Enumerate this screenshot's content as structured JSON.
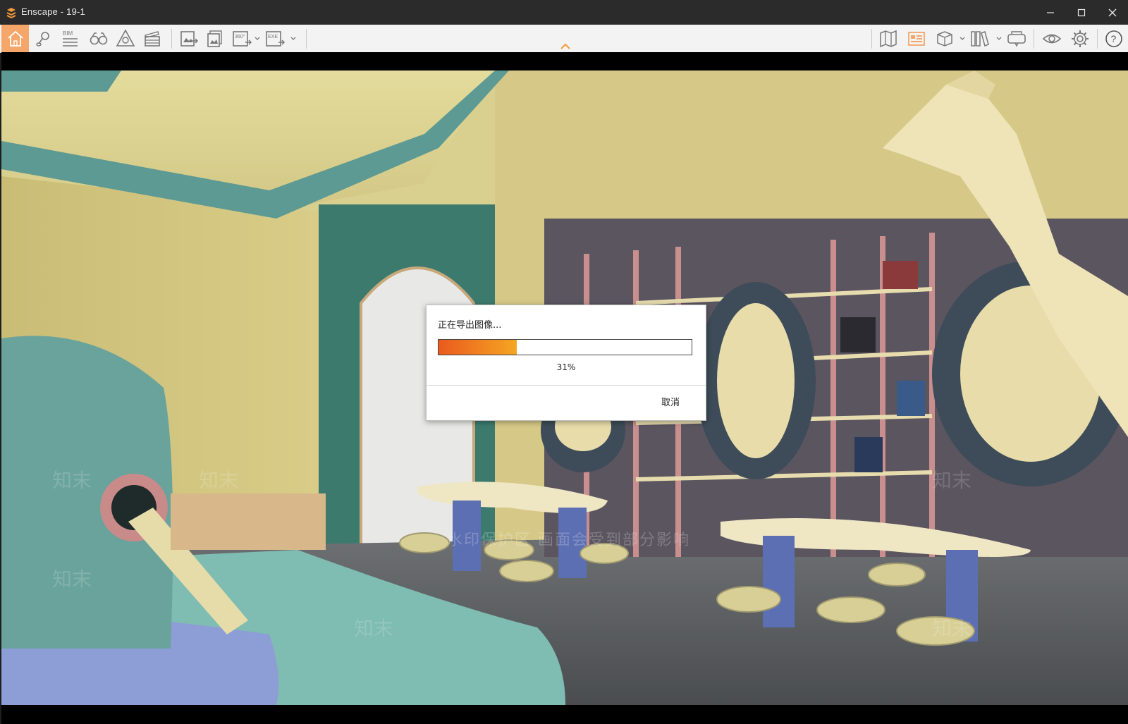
{
  "window": {
    "title": "Enscape - 19-1",
    "app_icon": "enscape-logo-icon",
    "buttons": [
      "minimize-icon",
      "maximize-icon",
      "close-icon"
    ]
  },
  "toolbar": {
    "left_tools": [
      {
        "name": "home-icon",
        "active": true
      },
      {
        "name": "location-pin-icon"
      },
      {
        "name": "bim-icon",
        "label": "BIM"
      },
      {
        "name": "binoculars-icon"
      },
      {
        "name": "asset-library-icon"
      },
      {
        "name": "clapper-video-icon"
      },
      {
        "name": "screenshot-export-icon"
      },
      {
        "name": "batch-render-icon"
      },
      {
        "name": "panorama-360-icon",
        "label": "360°"
      },
      {
        "name": "exe-export-icon",
        "label": "EXE"
      }
    ],
    "right_tools": [
      {
        "name": "map-icon"
      },
      {
        "name": "views-manager-icon"
      },
      {
        "name": "cube-icon"
      },
      {
        "name": "book-library-icon"
      },
      {
        "name": "vr-headset-icon"
      },
      {
        "name": "eye-icon"
      },
      {
        "name": "settings-gear-icon"
      },
      {
        "name": "help-icon"
      }
    ],
    "accent_color": "#f5a66a"
  },
  "watermark": {
    "banner_text": "水印保护区  画面会受到部分影响",
    "repeat_text": "知末"
  },
  "dialog": {
    "message": "正在导出图像...",
    "progress_value": 0.31,
    "progress_label": "31%",
    "cancel_label": "取消",
    "progress_colors": [
      "#ea5a1e",
      "#f5a623"
    ]
  }
}
